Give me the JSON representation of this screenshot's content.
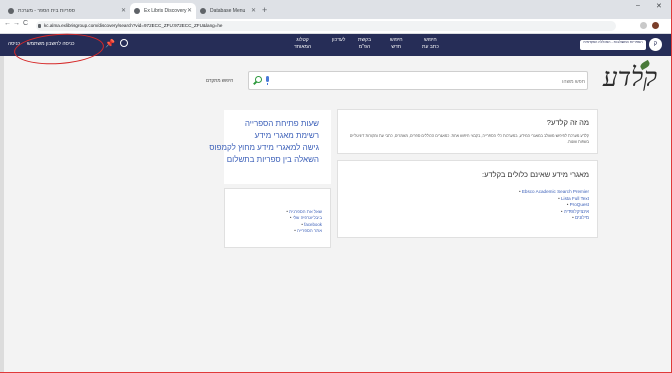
{
  "browser": {
    "tabs": [
      {
        "title": "ספריות בית הספר - מערכת",
        "active": false
      },
      {
        "title": "Ex Libris Discovery",
        "active": true
      },
      {
        "title": "Database Menu",
        "active": false
      }
    ],
    "new_tab": "+",
    "url": "kc.alma.exlibrisgroup.com/discovery/search?vid=972ECC_ZFU:972ECC_ZFU&lang=he",
    "window_controls": {
      "minimize": "–",
      "close": "✕"
    },
    "nav": {
      "back": "←",
      "forward": "→",
      "reload": "C"
    }
  },
  "site_nav": {
    "signin": "כניסה",
    "account": "כניסה לחשבון משתמש",
    "pin": "📌",
    "links": [
      "קטלוג\nהמאוחד",
      "לעדכון",
      "בקשת\nהפ\"מ",
      "חיפוש\nחדש",
      "חיפוש\nכתב עת"
    ],
    "logo_text": "הספריות המשולבות - המכללה האקדמית",
    "logo_mark": "ק"
  },
  "logo": {
    "text": "קלדע"
  },
  "search": {
    "placeholder": "חפש משהו",
    "advanced": "חיפוש מתקדם"
  },
  "about": {
    "title": "מה זה קלדע?",
    "text": "קלדע מערכת לחיפוש משולב במאגרי המידע, במערכות כלי הספרייה, בקבצי חיפוש אחת. כמאגרים הכוללים ספרים, מאמרים, כתבי עת ומקורות דיגיטליים בשפות שונות."
  },
  "databases": {
    "title": "מאגרי מידע שאינם כלולים בקלדע:",
    "items": [
      "Ebsco Academic Search Premier",
      "Lista Full Text",
      "ProQuest",
      "אינציקלופדיה",
      "מילונים"
    ]
  },
  "library_links": {
    "items": [
      "שעות פתיחת הספרייה",
      "רשימת מאגרי מידע",
      "גישה למאגרי מידע מחוץ לקמפוס",
      "השאלה בין ספריות בתשלום"
    ]
  },
  "more_links": {
    "items": [
      "שאל את הספרנית",
      "ביבליוגרפיה שלי",
      "facebook",
      "אתר הספרייה"
    ]
  }
}
